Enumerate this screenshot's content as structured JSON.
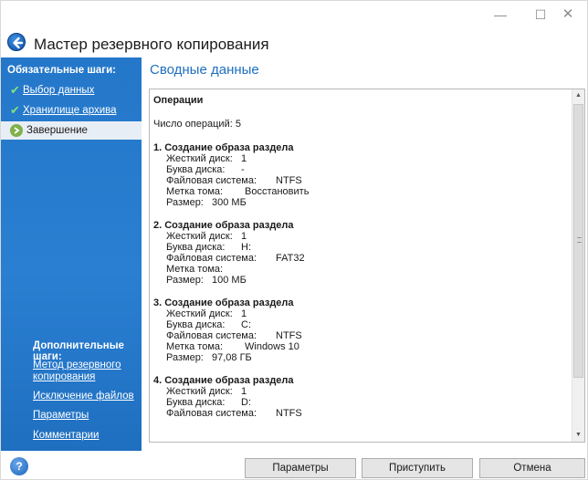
{
  "window": {
    "minimize_glyph": "—",
    "maximize_glyph": "☐",
    "close_glyph": "✕"
  },
  "header": {
    "title": "Мастер резервного копирования",
    "back_icon": "back-arrow-icon"
  },
  "sidebar": {
    "required_heading": "Обязательные шаги:",
    "required_steps": [
      {
        "label": "Выбор данных",
        "state": "done"
      },
      {
        "label": "Хранилище архива",
        "state": "done"
      },
      {
        "label": "Завершение",
        "state": "current"
      }
    ],
    "optional_heading": "Дополнительные шаги:",
    "optional_steps": [
      {
        "label_line1": "Метод резервного",
        "label_line2": "копирования"
      },
      {
        "label_line1": "Исключение файлов"
      },
      {
        "label_line1": "Параметры"
      },
      {
        "label_line1": "Комментарии"
      }
    ],
    "colors": {
      "background": "#2a7fd2",
      "check": "#7fe07f"
    }
  },
  "main": {
    "section_title": "Сводные данные",
    "summary": {
      "header": "Операции",
      "count_text": "Число операций: 5",
      "labels": {
        "disk": "Жесткий диск:",
        "letter": "Буква диска:",
        "fs": "Файловая система:",
        "volume": "Метка тома:",
        "size": "Размер:"
      },
      "operations": [
        {
          "title": "1. Создание образа раздела",
          "disk": "1",
          "letter": "-",
          "fs": "NTFS",
          "volume": "Восстановить",
          "size": "300 МБ"
        },
        {
          "title": "2. Создание образа раздела",
          "disk": "1",
          "letter": "H:",
          "fs": "FAT32",
          "volume": "",
          "size": "100 МБ"
        },
        {
          "title": "3. Создание образа раздела",
          "disk": "1",
          "letter": "C:",
          "fs": "NTFS",
          "volume": "Windows 10",
          "size": "97,08 ГБ"
        },
        {
          "title": "4. Создание образа раздела",
          "disk": "1",
          "letter": "D:",
          "fs": "NTFS"
        }
      ]
    }
  },
  "footer": {
    "help_glyph": "?",
    "params_button": "Параметры",
    "proceed_button": "Приступить",
    "cancel_button": "Отмена"
  },
  "colors": {
    "accent": "#1f6fc0"
  }
}
